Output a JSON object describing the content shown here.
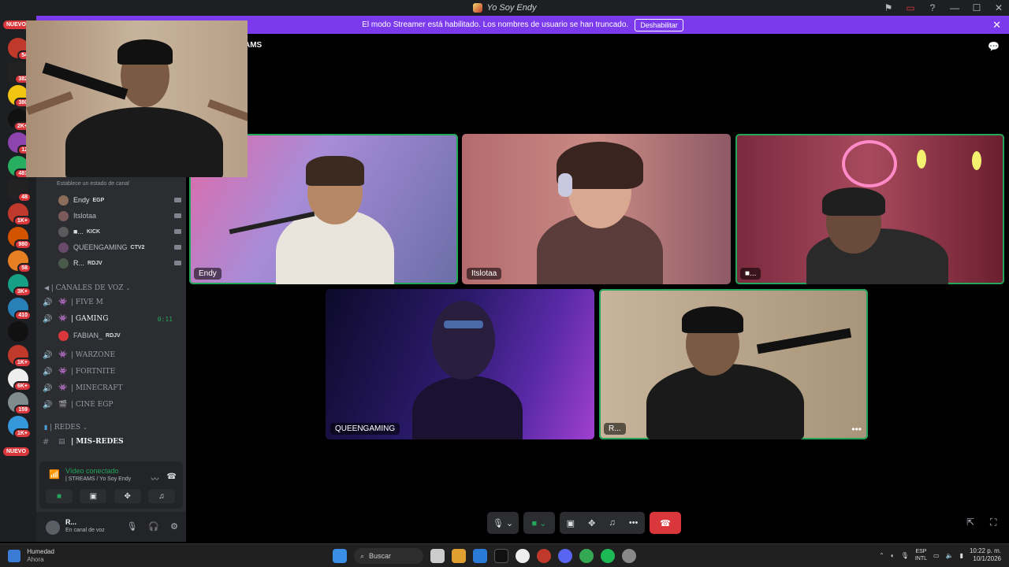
{
  "window": {
    "title": "Yo Soy Endy",
    "controls": [
      "⚑",
      "▭",
      "?",
      "—",
      "☐",
      "✕"
    ]
  },
  "banner": {
    "message": "El modo Streamer está habilitado. Los nombres de usuario se han truncado.",
    "button": "Deshabilitar"
  },
  "rail": {
    "top_label": "NUEVO",
    "bottom_label": "NUEVO",
    "badges": [
      "54",
      "382",
      "380",
      "2K+",
      "12",
      "481",
      "48",
      "1K+",
      "980",
      "58",
      "3K+",
      "410",
      "1K+",
      "6K+",
      "159",
      "1K+"
    ]
  },
  "sidebar": {
    "channel_status_hint": "Establece un estado de canal",
    "voice_users": [
      {
        "name": "Endy",
        "tag": "EGP",
        "tag_color": "#e8453c"
      },
      {
        "name": "Itslotaa",
        "tag": "",
        "tag_color": ""
      },
      {
        "name": "■...",
        "tag": "KICK",
        "tag_color": "#53fc18"
      },
      {
        "name": "QUEENGAMING",
        "tag": "CTV2",
        "tag_color": "#e8453c"
      },
      {
        "name": "R...",
        "tag": "RDJV",
        "tag_color": "#53fc18"
      }
    ],
    "voice_category": "| CANALES DE VOZ",
    "channels": [
      {
        "name": "| FIVE M",
        "time": ""
      },
      {
        "name": "| GAMING",
        "time": "0:11"
      },
      {
        "name": "| WARZONE",
        "time": ""
      },
      {
        "name": "| FORTNITE",
        "time": ""
      },
      {
        "name": "| MINECRAFT",
        "time": ""
      },
      {
        "name": "| CINE EGP",
        "time": ""
      }
    ],
    "gaming_member": {
      "name": "FABIAN_",
      "tag": "RDJV"
    },
    "redes_category": "| REDES",
    "text_channel": "| MIS-REDES"
  },
  "voice_panel": {
    "status": "Vídeo conectado",
    "channel": "| STREAMS / Yo Soy Endy"
  },
  "user_panel": {
    "name": "R...",
    "status": "En canal de voz"
  },
  "stage": {
    "channel_title": "AMS",
    "tiles": [
      {
        "label": "Endy"
      },
      {
        "label": "Itslotaa"
      },
      {
        "label": "■..."
      },
      {
        "label": "QUEENGAMING"
      },
      {
        "label": "R..."
      }
    ]
  },
  "taskbar": {
    "weather_title": "Humedad",
    "weather_sub": "Ahora",
    "search": "Buscar",
    "lang_top": "ESP",
    "lang_bottom": "INTL",
    "time": "10:22 p. m.",
    "date": "10/1/2026"
  }
}
